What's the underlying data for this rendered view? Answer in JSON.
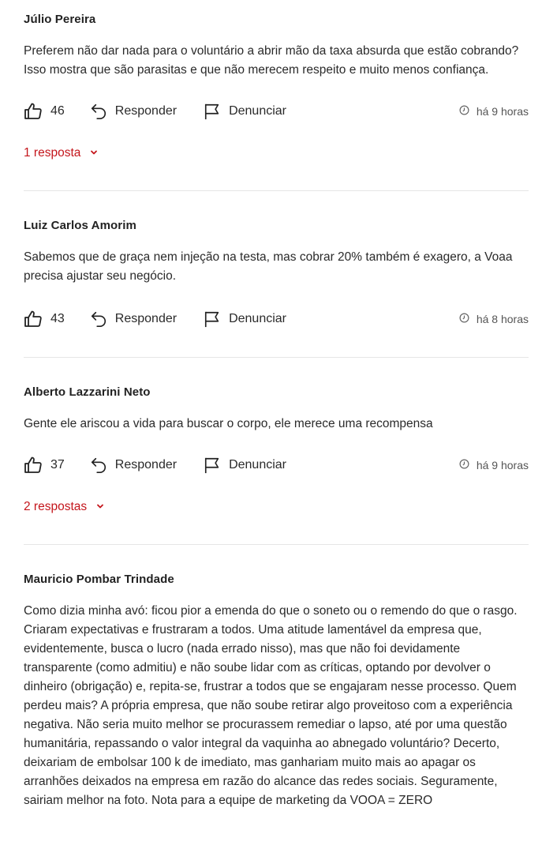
{
  "comments": [
    {
      "author": "Júlio Pereira",
      "text": "Preferem não dar nada para o voluntário a abrir mão da taxa absurda que estão cobrando? Isso mostra que são parasitas e que não merecem respeito e muito menos confiança.",
      "likes": "46",
      "reply_label": "Responder",
      "report_label": "Denunciar",
      "time": "há 9 horas",
      "replies_label": "1 resposta"
    },
    {
      "author": "Luiz Carlos Amorim",
      "text": "Sabemos que de graça nem injeção na testa, mas cobrar 20% também é exagero, a Voaa precisa ajustar seu negócio.",
      "likes": "43",
      "reply_label": "Responder",
      "report_label": "Denunciar",
      "time": "há 8 horas"
    },
    {
      "author": "Alberto Lazzarini Neto",
      "text": "Gente ele ariscou a vida para buscar o corpo, ele merece uma recompensa",
      "likes": "37",
      "reply_label": "Responder",
      "report_label": "Denunciar",
      "time": "há 9 horas",
      "replies_label": "2 respostas"
    },
    {
      "author": "Mauricio Pombar Trindade",
      "text": "Como dizia minha avó: ficou pior a emenda do que o soneto ou o remendo do que o rasgo. Criaram expectativas e frustraram a todos. Uma atitude lamentável da empresa que, evidentemente, busca o lucro (nada errado nisso), mas que não foi devidamente transparente (como admitiu) e não soube lidar com as críticas, optando por devolver o dinheiro (obrigação) e, repita-se, frustrar a todos que se engajaram nesse processo. Quem perdeu mais? A própria empresa, que não soube retirar algo proveitoso com a experiência negativa. Não seria muito melhor se procurassem remediar o lapso, até por uma questão humanitária, repassando o valor integral da vaquinha ao abnegado voluntário? Decerto, deixariam de embolsar 100 k de imediato, mas ganhariam muito mais ao apagar os arranhões deixados na empresa em razão do alcance das redes sociais. Seguramente, sairiam melhor na foto. Nota para a equipe de marketing da VOOA = ZERO"
    }
  ],
  "colors": {
    "accent": "#c4161c",
    "divider": "#e6e6e6",
    "text": "#2a2a2a",
    "muted": "#555555"
  },
  "icons": {
    "like": "thumbs-up-icon",
    "reply": "reply-arrow-icon",
    "report": "flag-icon",
    "time": "clock-icon",
    "expand": "chevron-down-icon"
  }
}
